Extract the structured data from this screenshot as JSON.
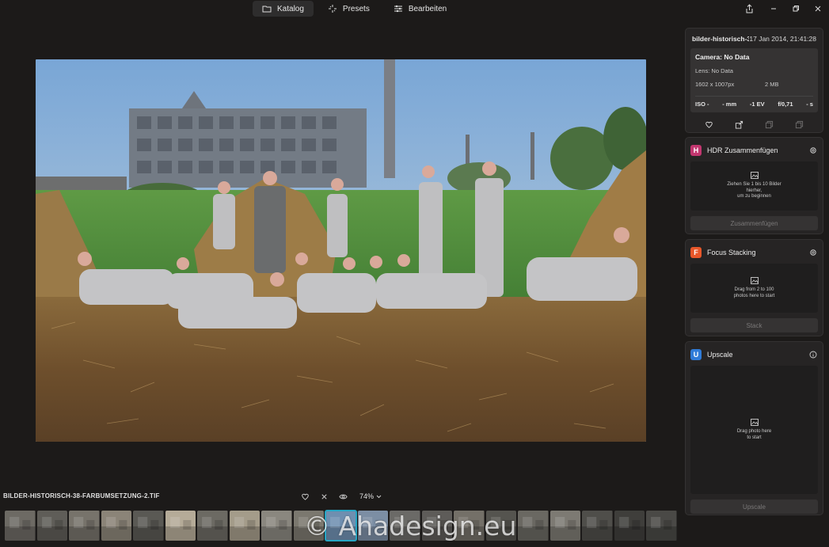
{
  "tabs": [
    {
      "label": "Katalog",
      "icon": "folder-icon"
    },
    {
      "label": "Presets",
      "icon": "sparkle-icon"
    },
    {
      "label": "Bearbeiten",
      "icon": "sliders-icon"
    }
  ],
  "file": {
    "name": "BILDER-HISTORISCH-38-FARBUMSETZUNG-2.TIF",
    "zoom": "74%"
  },
  "watermark": "© Ahadesign.eu",
  "info": {
    "filename": "bilder-historisch-38-farbumsetzung-2",
    "date": "17 Jan 2014, 21:41:28",
    "camera": "Camera: No Data",
    "lens": "Lens: No Data",
    "dimensions": "1602 x 1007px",
    "size": "2 MB",
    "iso": "ISO -",
    "focal": "- mm",
    "ev": "-1 EV",
    "aperture": "f/0,71",
    "shutter": "- s"
  },
  "tools": {
    "hdr": {
      "badge": "H",
      "title": "HDR Zusammenfügen",
      "drop_line1": "Ziehen Sie 1 bis 10 Bilder",
      "drop_line2": "hierher,",
      "drop_line3": "um zu beginnen",
      "button": "Zusammenfügen",
      "color": "#c2366f"
    },
    "focus": {
      "badge": "F",
      "title": "Focus Stacking",
      "drop_line1": "Drag from 2 to 100",
      "drop_line2": "photos here to start",
      "button": "Stack",
      "color": "#e8572a"
    },
    "upscale": {
      "badge": "U",
      "title": "Upscale",
      "drop_line1": "Drag photo here",
      "drop_line2": "to start",
      "button": "Upscale",
      "color": "#2f7bd8"
    }
  },
  "filmstrip": {
    "count": 21,
    "selected_index": 10
  },
  "colors": {
    "accent": "#27a6c4",
    "background": "#1c1a19",
    "panel": "#262424"
  }
}
